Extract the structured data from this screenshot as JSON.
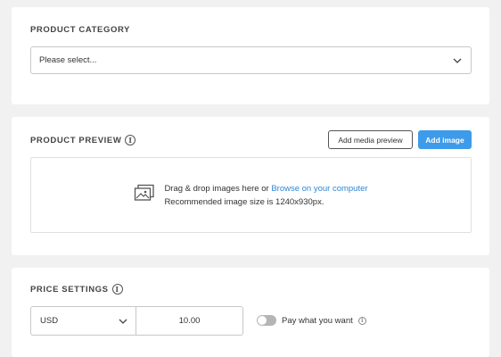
{
  "category": {
    "title": "PRODUCT CATEGORY",
    "select_value": "Please select..."
  },
  "preview": {
    "title": "PRODUCT PREVIEW",
    "add_media_label": "Add media preview",
    "add_image_label": "Add image",
    "drop_text": "Drag & drop images here or ",
    "browse_link": "Browse on your computer",
    "size_hint": "Recommended image size is 1240x930px."
  },
  "price": {
    "title": "PRICE SETTINGS",
    "currency": "USD",
    "amount": "10.00",
    "pay_what_you_want_label": "Pay what you want",
    "pay_what_you_want_enabled": false
  },
  "icons": {
    "info": "info-icon",
    "chevron": "chevron-down-icon",
    "image": "image-gallery-icon"
  },
  "colors": {
    "primary": "#3d9be9",
    "link": "#2f86d6",
    "background": "#f1f1f1"
  }
}
